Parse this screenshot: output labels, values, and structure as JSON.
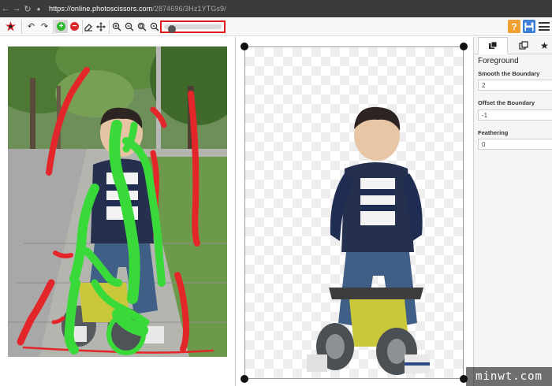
{
  "browser": {
    "back_icon": "arrow-left-icon",
    "forward_icon": "arrow-right-icon",
    "reload_icon": "reload-icon",
    "lock_icon": "lock-icon",
    "url_host": "https://online.photoscissors.com",
    "url_path": "/2874696/3Hz1YTGs9/"
  },
  "toolbar": {
    "logo_icon": "photoscissors-logo-icon",
    "tools": [
      "undo-icon",
      "redo-icon",
      "foreground-marker-icon",
      "background-marker-icon",
      "eraser-icon",
      "move-icon",
      "zoom-in-icon",
      "zoom-out-icon",
      "zoom-fit-icon",
      "zoom-actual-icon"
    ],
    "marker_size_level": 0.05,
    "help_label": "?",
    "accent_fg": "#2eb82e",
    "accent_bg": "#d9262a",
    "highlight": "#e0191b"
  },
  "panel": {
    "tabs": [
      "foreground-tab-icon",
      "background-tab-icon",
      "star-tab-icon"
    ],
    "title": "Foreground",
    "fields": [
      {
        "label": "Smooth the Boundary",
        "value": "2"
      },
      {
        "label": "Offset the Boundary",
        "value": "-1"
      },
      {
        "label": "Feathering",
        "value": "0"
      }
    ]
  },
  "watermark": "minwt.com"
}
